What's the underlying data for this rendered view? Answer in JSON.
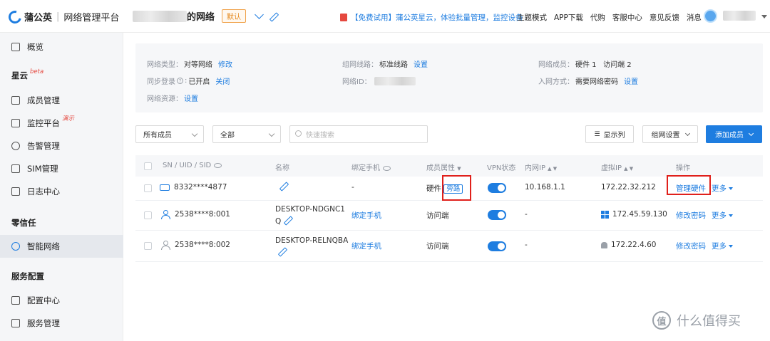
{
  "header": {
    "brand": "蒲公英",
    "separator": "|",
    "platform": "网络管理平台",
    "network_name": "的网络",
    "default_badge": "默认",
    "promo": "【免费试用】蒲公英星云，体验批量管理，监控设备",
    "nav": [
      "主题模式",
      "APP下载",
      "代购",
      "客服中心",
      "意见反馈",
      "消息"
    ]
  },
  "sidebar": {
    "overview": "概览",
    "section_xingyun": "星云",
    "beta": "beta",
    "member_mgmt": "成员管理",
    "monitor": "监控平台",
    "demo": "演示",
    "alarm": "告警管理",
    "sim": "SIM管理",
    "log": "日志中心",
    "section_zero_trust": "零信任",
    "smart_network": "智能网络",
    "section_service": "服务配置",
    "config_center": "配置中心",
    "service_mgmt": "服务管理"
  },
  "info": {
    "network_type_label": "网络类型：",
    "network_type_value": "对等网络",
    "modify": "修改",
    "sync_login_label": "同步登录",
    "sync_login_value": "已开启",
    "close": "关闭",
    "resource_label": "网络资源：",
    "setting": "设置",
    "route_label": "组网线路：",
    "route_value": "标准线路",
    "network_id_label": "网络ID：",
    "members_label": "网络成员：",
    "members_value": "硬件 1   访问端 2",
    "join_label": "入网方式：",
    "join_value": "需要网络密码"
  },
  "toolbar": {
    "filter_members": "所有成员",
    "filter_all": "全部",
    "search_placeholder": "快速搜索",
    "show_columns": "显示列",
    "network_settings": "组网设置",
    "add_member": "添加成员"
  },
  "table": {
    "headers": {
      "sn": "SN / UID / SID",
      "name": "名称",
      "phone": "绑定手机",
      "attr": "成员属性",
      "vpn": "VPN状态",
      "lan_ip": "内网IP",
      "virtual_ip": "虚拟IP",
      "ops": "操作"
    },
    "sort_arrows": "▲ ▼",
    "rows": [
      {
        "sn": "8332****4877",
        "name": "",
        "phone": "-",
        "attr": "硬件",
        "attr_tag": "旁路",
        "lan_ip": "10.168.1.1",
        "virtual_ip": "172.22.32.212",
        "action": "管理硬件",
        "more": "更多"
      },
      {
        "sn": "2538****8:001",
        "name_line1": "DESKTOP-NDGNC1",
        "name_line2": "Q",
        "phone": "绑定手机",
        "attr": "访问端",
        "lan_ip": "-",
        "virtual_ip": "172.45.59.130",
        "action": "修改密码",
        "more": "更多"
      },
      {
        "sn": "2538****8:002",
        "name_line1": "DESKTOP-RELNQBA",
        "phone": "绑定手机",
        "attr": "访问端",
        "lan_ip": "-",
        "virtual_ip": "172.22.4.60",
        "action": "修改密码",
        "more": "更多"
      }
    ]
  },
  "watermark": {
    "badge": "值",
    "text": "什么值得买"
  }
}
